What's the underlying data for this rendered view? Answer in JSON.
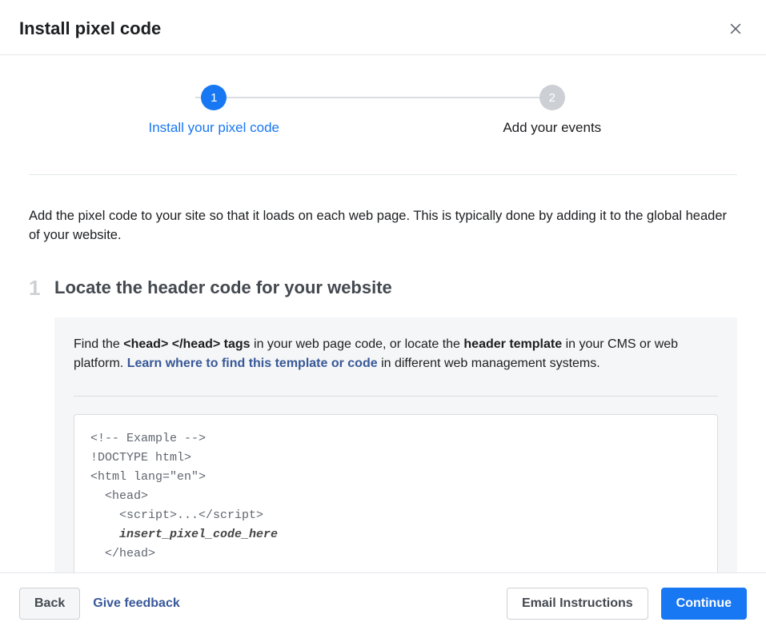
{
  "header": {
    "title": "Install pixel code"
  },
  "stepper": {
    "step1": {
      "number": "1",
      "label": "Install your pixel code"
    },
    "step2": {
      "number": "2",
      "label": "Add your events"
    }
  },
  "intro": "Add the pixel code to your site so that it loads on each web page. This is typically done by adding it to the global header of your website.",
  "instruction": {
    "number": "1",
    "title": "Locate the header code for your website",
    "desc_part1": "Find the ",
    "desc_bold1": "<head> </head> tags",
    "desc_part2": " in your web page code, or locate the ",
    "desc_bold2": "header template",
    "desc_part3": " in your CMS or web platform. ",
    "desc_link": "Learn where to find this template or code",
    "desc_part4": " in different web management systems.",
    "code_line1": "<!-- Example -->",
    "code_line2": "!DOCTYPE html>",
    "code_line3": "<html lang=\"en\">",
    "code_line4": "  <head>",
    "code_line5": "    <script>...</scr",
    "code_line5b": "ipt>",
    "code_line6_bold": "    insert_pixel_code_here",
    "code_line7": "  </head>"
  },
  "footer": {
    "back": "Back",
    "feedback": "Give feedback",
    "email": "Email Instructions",
    "continue": "Continue"
  }
}
